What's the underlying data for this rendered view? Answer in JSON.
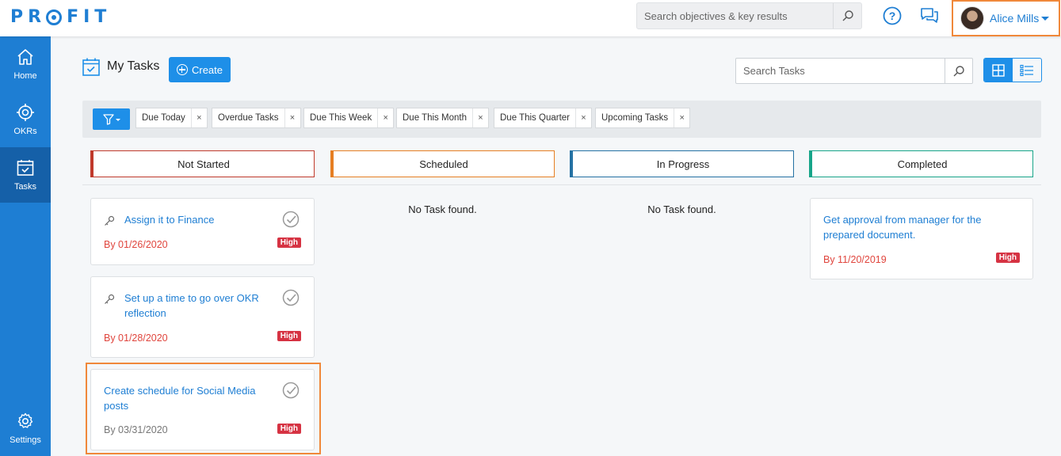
{
  "header": {
    "logo": "PROFIT",
    "search_placeholder": "Search objectives & key results",
    "user_name": "Alice Mills"
  },
  "sidebar": {
    "items": [
      {
        "label": "Home",
        "icon": "home-icon"
      },
      {
        "label": "OKRs",
        "icon": "target-icon"
      },
      {
        "label": "Tasks",
        "icon": "calendar-check-icon",
        "active": true
      },
      {
        "label": "Settings",
        "icon": "gear-icon"
      }
    ]
  },
  "page": {
    "title": "My Tasks",
    "create_label": "Create",
    "search_placeholder": "Search Tasks"
  },
  "filters": [
    "Due Today",
    "Overdue Tasks",
    "Due This Week",
    "Due This Month",
    "Due This Quarter",
    "Upcoming Tasks"
  ],
  "columns": [
    {
      "label": "Not Started",
      "color": "#c0392b"
    },
    {
      "label": "Scheduled",
      "color": "#e67e22"
    },
    {
      "label": "In Progress",
      "color": "#2471a3"
    },
    {
      "label": "Completed",
      "color": "#17a589"
    }
  ],
  "empty_text": "No Task found.",
  "cards": {
    "not_started": [
      {
        "title": "Assign it to Finance",
        "due": "By 01/26/2020",
        "priority": "High"
      },
      {
        "title_line1": "Set up a time to go over OKR",
        "title_line2": "reflection",
        "due": "By 01/28/2020",
        "priority": "High"
      },
      {
        "title_line1": "Create schedule for Social Media",
        "title_line2": "posts",
        "due": "By 03/31/2020",
        "priority": "High"
      }
    ],
    "completed": [
      {
        "title_line1": "Get approval from manager for the",
        "title_line2": "prepared document.",
        "due": "By 11/20/2019",
        "priority": "High"
      }
    ]
  }
}
